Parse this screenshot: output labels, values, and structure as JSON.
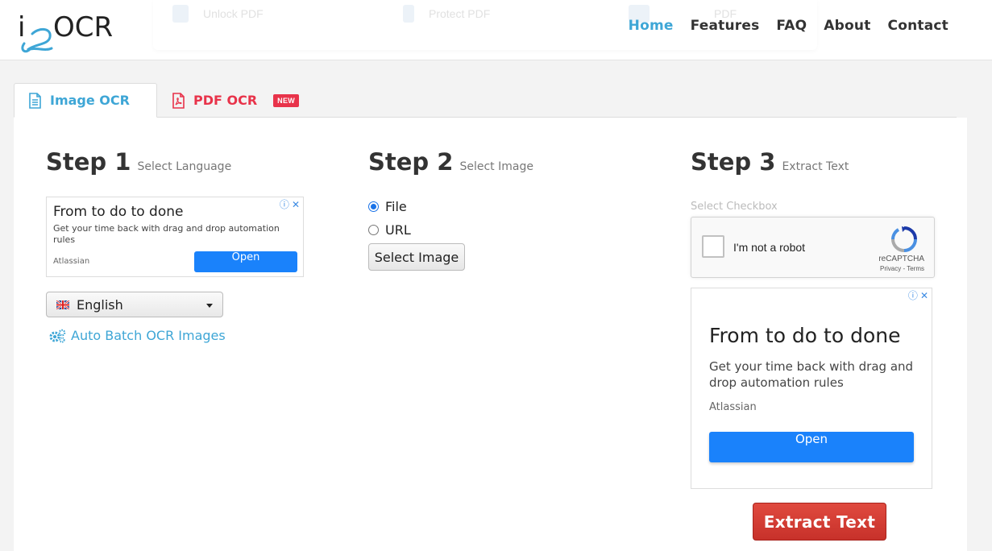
{
  "header": {
    "logo_prefix": "i",
    "logo_text": "OCR",
    "ghost_tools": [
      "Unlock PDF",
      "Protect PDF",
      "PDF"
    ],
    "nav": [
      {
        "label": "Home",
        "active": true
      },
      {
        "label": "Features",
        "active": false
      },
      {
        "label": "FAQ",
        "active": false
      },
      {
        "label": "About",
        "active": false
      },
      {
        "label": "Contact",
        "active": false
      }
    ]
  },
  "tabs": {
    "image_ocr": "Image OCR",
    "pdf_ocr": "PDF OCR",
    "new_badge": "NEW"
  },
  "step1": {
    "number": "Step 1",
    "subtitle": "Select Language",
    "ad": {
      "title": "From to do to done",
      "description": "Get your time back with drag and drop automation rules",
      "brand": "Atlassian",
      "button": "Open"
    },
    "language": "English",
    "batch_link": "Auto Batch OCR Images"
  },
  "step2": {
    "number": "Step 2",
    "subtitle": "Select Image",
    "options": [
      {
        "label": "File",
        "checked": true
      },
      {
        "label": "URL",
        "checked": false
      }
    ],
    "select_button": "Select Image"
  },
  "step3": {
    "number": "Step 3",
    "subtitle": "Extract Text",
    "checkbox_label": "Select Checkbox",
    "recaptcha": {
      "label": "I'm not a robot",
      "brand": "reCAPTCHA",
      "terms": "Privacy - Terms"
    },
    "ad": {
      "title": "From to do to done",
      "description": "Get your time back with drag and drop automation rules",
      "brand": "Atlassian",
      "button": "Open"
    },
    "extract_button": "Extract Text"
  },
  "colors": {
    "accent": "#3ea6d6",
    "pdf_red": "#e8334a",
    "ad_blue": "#1a82fb",
    "extract_red": "#d23b33"
  }
}
